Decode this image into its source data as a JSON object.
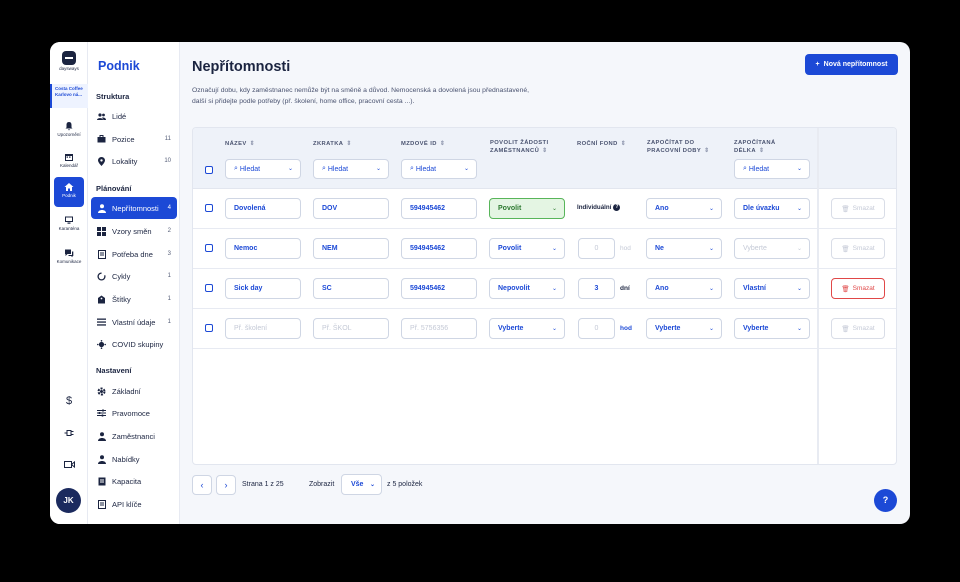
{
  "app": {
    "logo_text": "daysways",
    "org_name": "Costa Coffee Karlovo ná..."
  },
  "rail": {
    "items": [
      {
        "label": "Upozornění",
        "icon": "bell-icon"
      },
      {
        "label": "Kalendář",
        "icon": "calendar-icon"
      },
      {
        "label": "Podnik",
        "icon": "home-icon"
      },
      {
        "label": "Karanténa",
        "icon": "monitor-icon"
      },
      {
        "label": "Komunikace",
        "icon": "chat-icon"
      }
    ],
    "bottom": [
      {
        "label": "$",
        "icon": "dollar-icon"
      },
      {
        "label": "⊸",
        "icon": "plug-icon"
      },
      {
        "label": "▭",
        "icon": "video-icon"
      }
    ],
    "avatar": "JK"
  },
  "sidebar": {
    "title": "Podnik",
    "sections": [
      "Struktura",
      "Plánování",
      "Nastavení"
    ],
    "struktura": [
      {
        "label": "Lidé",
        "count": ""
      },
      {
        "label": "Pozice",
        "count": "11"
      },
      {
        "label": "Lokality",
        "count": "10"
      }
    ],
    "planovani": [
      {
        "label": "Nepřítomnosti",
        "count": "4"
      },
      {
        "label": "Vzory směn",
        "count": "2"
      },
      {
        "label": "Potřeba dne",
        "count": "3"
      },
      {
        "label": "Cykly",
        "count": "1"
      },
      {
        "label": "Štítky",
        "count": "1"
      },
      {
        "label": "Vlastní údaje",
        "count": "1"
      },
      {
        "label": "COVID skupiny",
        "count": ""
      }
    ],
    "nastaveni": [
      {
        "label": "Základní"
      },
      {
        "label": "Pravomoce"
      },
      {
        "label": "Zaměstnanci"
      },
      {
        "label": "Nabídky"
      },
      {
        "label": "Kapacita"
      },
      {
        "label": "API klíče"
      }
    ]
  },
  "page": {
    "title": "Nepřítomnosti",
    "description": "Označují dobu, kdy zaměstnanec nemůže být na směně a důvod. Nemocenská a dovolená jsou přednastavené, další si přidejte podle potřeby (př. školení, home office, pracovní cesta ...).",
    "new_button": "Nová nepřítomnost"
  },
  "table": {
    "headers": [
      "NÁZEV",
      "ZKRATKA",
      "MZDOVÉ ID",
      "POVOLIT ŽÁDOSTI ZAMĚSTNANCŮ",
      "ROČNÍ FOND",
      "ZAPOČÍTAT DO PRACOVNÍ DOBY",
      "ZAPOČÍTANÁ DÉLKA"
    ],
    "filter_placeholder": "Hledat",
    "rows": [
      {
        "name": "Dovolená",
        "short": "DOV",
        "payroll": "594945462",
        "allow": "Povolit",
        "fund": "Individuální",
        "fund_value": "",
        "fund_unit": "",
        "count": "Ano",
        "length": "Dle úvazku",
        "delete": "Smazat"
      },
      {
        "name": "Nemoc",
        "short": "NEM",
        "payroll": "594945462",
        "allow": "Povolit",
        "fund": "",
        "fund_value": "0",
        "fund_unit": "hod",
        "count": "Ne",
        "length": "Vyberte",
        "delete": "Smazat"
      },
      {
        "name": "Sick day",
        "short": "SC",
        "payroll": "594945462",
        "allow": "Nepovolit",
        "fund": "",
        "fund_value": "3",
        "fund_unit": "dní",
        "count": "Ano",
        "length": "Vlastní",
        "delete": "Smazat"
      },
      {
        "name": "Př. školení",
        "short": "Př. ŠKOL",
        "payroll": "Př. 5756356",
        "allow": "Vyberte",
        "fund": "",
        "fund_value": "0",
        "fund_unit": "hod",
        "count": "Vyberte",
        "length": "Vyberte",
        "delete": "Smazat"
      }
    ]
  },
  "pagination": {
    "page_text": "Strana 1 z 25",
    "show_label": "Zobrazit",
    "show_value": "Vše",
    "total_text": "z 5 položek"
  },
  "help": "?",
  "colors": {
    "accent": "#1c49d6",
    "success_bg": "#e4f5e3",
    "danger": "#e04848"
  }
}
